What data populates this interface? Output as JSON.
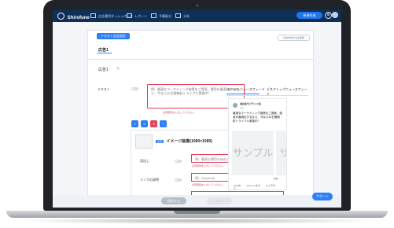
{
  "app": {
    "brand": "Shirofune",
    "top_nav": [
      {
        "label": "広告運用ダッシュボード"
      },
      {
        "label": "レポート"
      },
      {
        "label": "予算配分"
      },
      {
        "label": "分析"
      }
    ],
    "top_button": "新規作成",
    "gear_symbol": "⚙"
  },
  "editor": {
    "tab_label": "テキスト広告設定",
    "top_right_link": "広告作成方法を確認",
    "draft_title": "広告1",
    "draft_name": "広告1",
    "edit_symbol": "✎",
    "text_label": "テキスト",
    "text_placeholder": "例）最適なマーケティング施策をご提案。運用を最適化するなら、今なら30日間無料トライアル実施中！",
    "text_error": "必須項目を入力してください。",
    "text_count": "0 / 125",
    "step_1": "1",
    "step_2": "2",
    "step_3": "3",
    "step_4": "+",
    "image_badge": "必須",
    "image_title": "イメージ画像(1080×1080)",
    "select_button": "選択",
    "headline_label": "見出し",
    "headline_placeholder": "例）最適な運用を始めましょう",
    "headline_error": "必須項目を入力してください。",
    "link_label": "リンクの説明",
    "link_placeholder": "例）Shirofune",
    "link_error": "必須項目を入力してください。",
    "url_label": "広告リンク先URL",
    "url_placeholder": "https://www.shirofune.com",
    "url_error": "必須項目を入力してください。"
  },
  "preview": {
    "mobile_tab": "モバイルニュースフィード",
    "desktop_tab": "デスクトップニュースフィード",
    "company": "会社名やブランド名",
    "meta": "広告",
    "post_text": "最適なマーケティング施策をご提案。運用を最適化するなら、今なら30日間無料トライアル実施中！",
    "sample_main": "サンプル3",
    "sample_second": "サ",
    "sample_caption": "詳細",
    "actions": [
      "いいね",
      "コメントする",
      "シェアする"
    ]
  },
  "footer": {
    "save_draft": "保存する",
    "next": "次へ",
    "support": "サポート"
  },
  "colors": {
    "accent": "#2d7ff9",
    "header": "#0f2f57",
    "error": "#ea3b5a"
  }
}
